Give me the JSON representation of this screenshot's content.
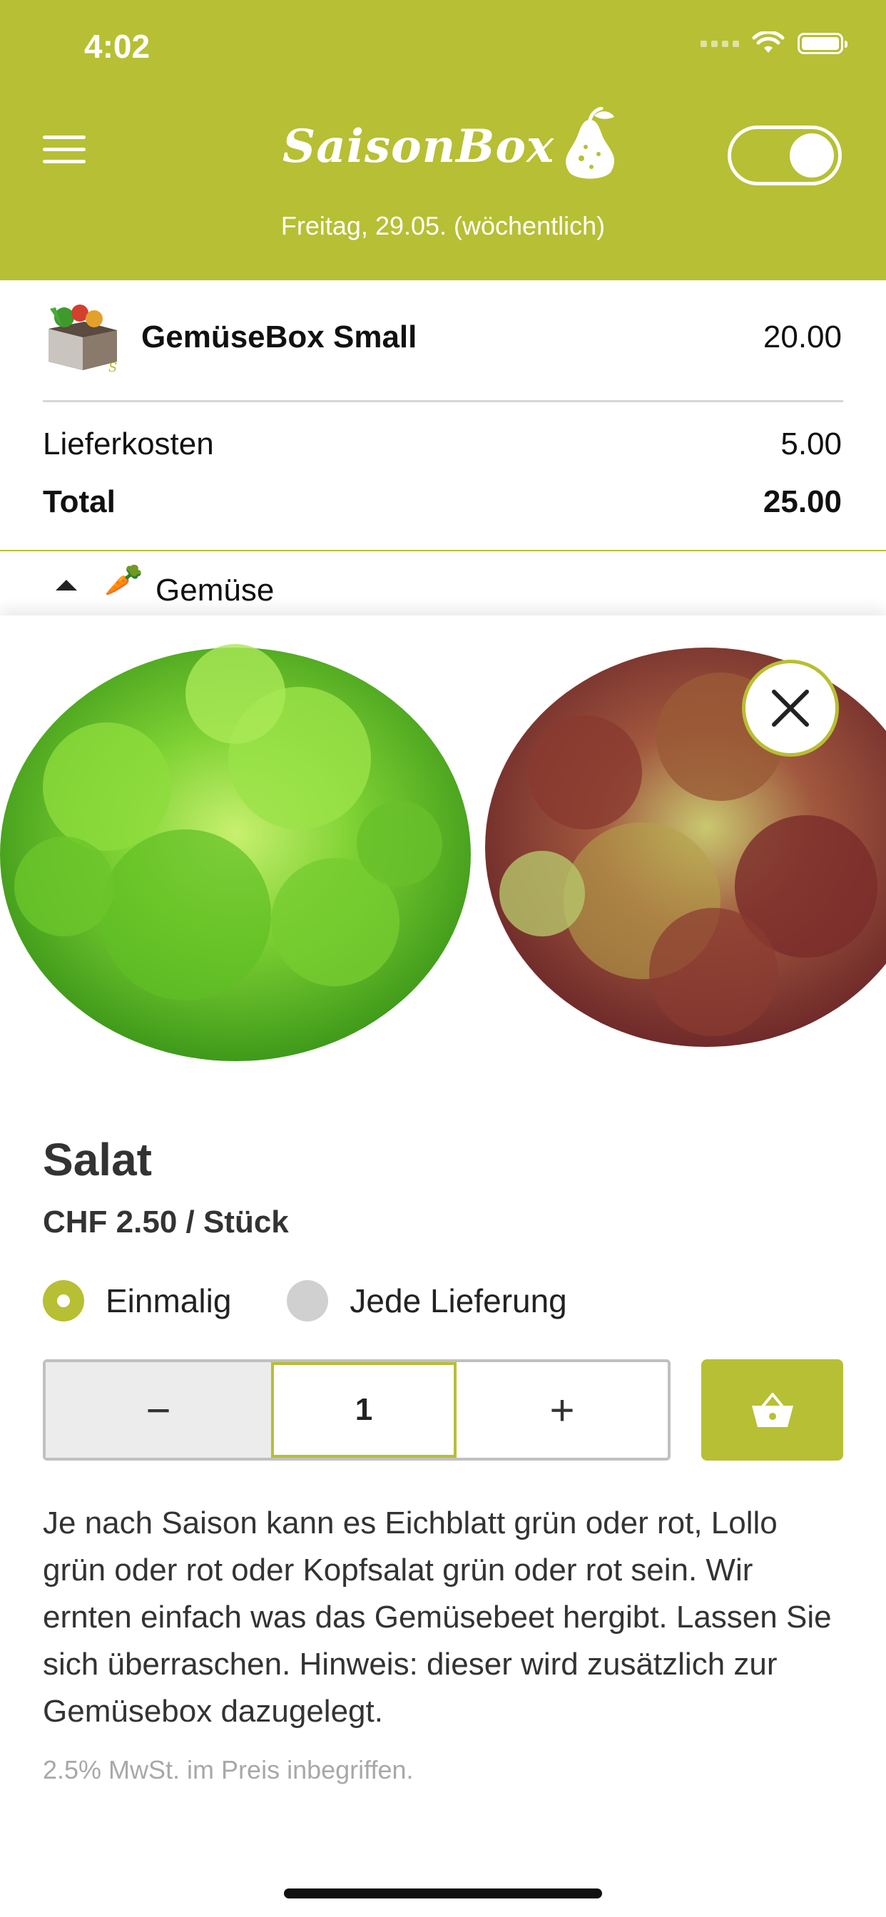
{
  "status_bar": {
    "time": "4:02"
  },
  "header": {
    "logo_text": "SaisonBox",
    "subtitle": "Freitag, 29.05. (wöchentlich)",
    "brand_color": "#b7bf34"
  },
  "summary": {
    "product_name": "GemüseBox Small",
    "product_price": "20.00",
    "delivery_label": "Lieferkosten",
    "delivery_value": "5.00",
    "total_label": "Total",
    "total_value": "25.00"
  },
  "category": {
    "emoji": "🥕",
    "label": "Gemüse"
  },
  "product": {
    "name": "Salat",
    "price": "CHF 2.50 / Stück",
    "option_once": "Einmalig",
    "option_every": "Jede Lieferung",
    "selected_option": "Einmalig",
    "quantity": "1",
    "minus_label": "−",
    "plus_label": "+",
    "description": "Je nach Saison kann es Eichblatt grün oder rot, Lollo grün oder rot oder Kopfsalat grün oder rot sein. Wir ernten einfach was das Gemüsebeet hergibt. Lassen Sie sich überraschen.  Hinweis: dieser wird zusätzlich zur Gemüsebox dazugelegt.",
    "vat_note": "2.5% MwSt. im Preis inbegriffen."
  },
  "icons": {
    "menu": "hamburger-icon",
    "close": "close-icon",
    "cart": "basket-icon",
    "wifi": "wifi-icon",
    "battery": "battery-icon"
  }
}
